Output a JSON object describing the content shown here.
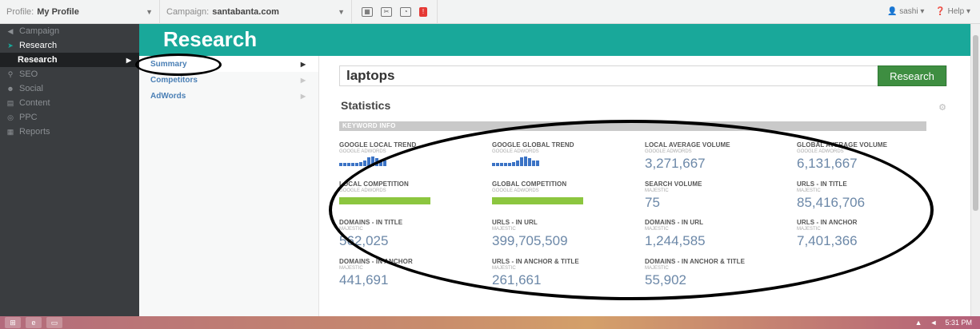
{
  "topbar": {
    "profile_label": "Profile:",
    "profile_value": "My Profile",
    "campaign_label": "Campaign:",
    "campaign_value": "santabanta.com",
    "user": "sashi",
    "help": "Help"
  },
  "sidebar": {
    "items": [
      {
        "label": "Campaign",
        "icon": "megaphone-icon"
      },
      {
        "label": "Research",
        "icon": "cursor-icon"
      },
      {
        "label": "Research",
        "icon": ""
      },
      {
        "label": "SEO",
        "icon": "link-icon"
      },
      {
        "label": "Social",
        "icon": "people-icon"
      },
      {
        "label": "Content",
        "icon": "document-icon"
      },
      {
        "label": "PPC",
        "icon": "target-icon"
      },
      {
        "label": "Reports",
        "icon": "table-icon"
      }
    ]
  },
  "header": {
    "title": "Research"
  },
  "subnav": {
    "items": [
      {
        "label": "Summary"
      },
      {
        "label": "Competitors"
      },
      {
        "label": "AdWords"
      }
    ]
  },
  "search": {
    "value": "laptops",
    "button": "Research"
  },
  "statistics": {
    "title": "Statistics",
    "section_label": "KEYWORD INFO",
    "local_trend": {
      "label": "GOOGLE LOCAL TREND",
      "source": "GOOGLE ADWORDS",
      "bars": [
        0.3,
        0.3,
        0.3,
        0.3,
        0.35,
        0.4,
        0.55,
        0.9,
        1.0,
        0.85,
        0.6,
        0.55
      ]
    },
    "global_trend": {
      "label": "GOOGLE GLOBAL TREND",
      "source": "GOOGLE ADWORDS",
      "bars": [
        0.3,
        0.3,
        0.3,
        0.3,
        0.35,
        0.4,
        0.55,
        0.9,
        1.0,
        0.85,
        0.6,
        0.55
      ]
    },
    "local_avg_volume": {
      "label": "LOCAL AVERAGE VOLUME",
      "source": "GOOGLE ADWORDS",
      "value": "3,271,667"
    },
    "global_avg_volume": {
      "label": "GLOBAL AVERAGE VOLUME",
      "source": "GOOGLE ADWORDS",
      "value": "6,131,667"
    },
    "local_competition": {
      "label": "LOCAL COMPETITION",
      "source": "GOOGLE ADWORDS",
      "level": 1.0
    },
    "global_competition": {
      "label": "GLOBAL COMPETITION",
      "source": "GOOGLE ADWORDS",
      "level": 1.0
    },
    "search_volume": {
      "label": "SEARCH VOLUME",
      "source": "MAJESTIC",
      "value": "75"
    },
    "urls_in_title": {
      "label": "URLS - IN TITLE",
      "source": "MAJESTIC",
      "value": "85,416,706"
    },
    "domains_in_title": {
      "label": "DOMAINS - IN TITLE",
      "source": "MAJESTIC",
      "value": "562,025"
    },
    "urls_in_url": {
      "label": "URLS - IN URL",
      "source": "MAJESTIC",
      "value": "399,705,509"
    },
    "domains_in_url": {
      "label": "DOMAINS - IN URL",
      "source": "MAJESTIC",
      "value": "1,244,585"
    },
    "urls_in_anchor": {
      "label": "URLS - IN ANCHOR",
      "source": "MAJESTIC",
      "value": "7,401,366"
    },
    "domains_in_anchor": {
      "label": "DOMAINS - IN ANCHOR",
      "source": "MAJESTIC",
      "value": "441,691"
    },
    "urls_in_anchor_title": {
      "label": "URLS - IN ANCHOR & TITLE",
      "source": "MAJESTIC",
      "value": "261,661"
    },
    "domains_in_anchor_title": {
      "label": "DOMAINS - IN ANCHOR & TITLE",
      "source": "MAJESTIC",
      "value": "55,902"
    }
  },
  "taskbar": {
    "time": "5:31 PM"
  },
  "colors": {
    "header": "#19a89a",
    "sidebar": "#3a3d40",
    "button": "#3e8e41",
    "value": "#6c88a8",
    "trend": "#3b73c5",
    "competition": "#8cc63f"
  }
}
